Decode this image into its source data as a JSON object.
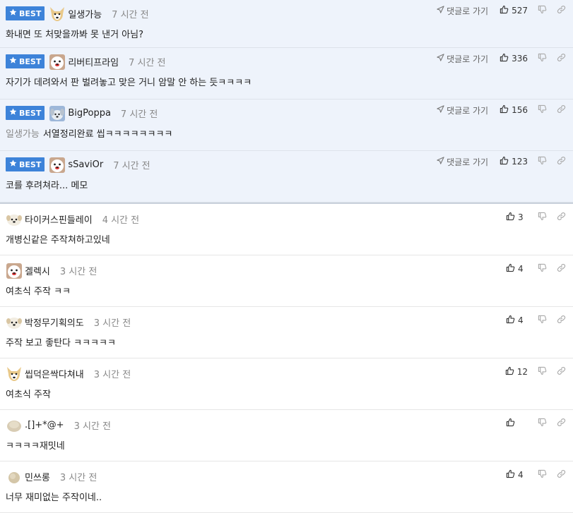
{
  "best_label": "BEST",
  "reply_label": "댓글로 가기",
  "comments": [
    {
      "type": "best",
      "avatar": "dog-face",
      "nick": "일생가능",
      "time": "7 시간 전",
      "mention": "",
      "text": "화내면 또 처맞을까봐 못 낸거 아님?",
      "likes": "527"
    },
    {
      "type": "best",
      "avatar": "pig-face",
      "nick": "리버티프라임",
      "time": "7 시간 전",
      "mention": "",
      "text": "자기가 데려와서 판 벌려놓고 맞은 거니 암말 안 하는 듯ㅋㅋㅋㅋ",
      "likes": "336"
    },
    {
      "type": "best",
      "avatar": "dog-plush",
      "nick": "BigPoppa",
      "time": "7 시간 전",
      "mention": "일생가능",
      "text": "서열정리완료 씹ㅋㅋㅋㅋㅋㅋㅋㅋ",
      "likes": "156"
    },
    {
      "type": "best",
      "avatar": "pig-face",
      "nick": "sSaviOr",
      "time": "7 시간 전",
      "mention": "",
      "text": "코를 후려쳐라... 메모",
      "likes": "123"
    },
    {
      "type": "normal",
      "avatar": "puppy-face",
      "nick": "타이커스핀들레이",
      "time": "4 시간 전",
      "mention": "",
      "text": "개병신같은 주작쳐하고있네",
      "likes": "3"
    },
    {
      "type": "normal",
      "avatar": "pig-face",
      "nick": "겔렉시",
      "time": "3 시간 전",
      "mention": "",
      "text": "여초식 주작 ㅋㅋ",
      "likes": "4"
    },
    {
      "type": "normal",
      "avatar": "puppy-face",
      "nick": "박정무기획의도",
      "time": "3 시간 전",
      "mention": "",
      "text": "주작 보고 좋탄다 ㅋㅋㅋㅋㅋ",
      "likes": "4"
    },
    {
      "type": "normal",
      "avatar": "dog-face",
      "nick": "씹덕은싹다쳐내",
      "time": "3 시간 전",
      "mention": "",
      "text": "여초식 주작",
      "likes": "12"
    },
    {
      "type": "normal",
      "avatar": "blob",
      "nick": ".[]+*@+",
      "time": "3 시간 전",
      "mention": "",
      "text": "ㅋㅋㅋㅋ재밋네",
      "likes": ""
    },
    {
      "type": "normal",
      "avatar": "blob-small",
      "nick": "민쓰롱",
      "time": "3 시간 전",
      "mention": "",
      "text": "너무 재미없는 주작이네..",
      "likes": "4"
    }
  ]
}
